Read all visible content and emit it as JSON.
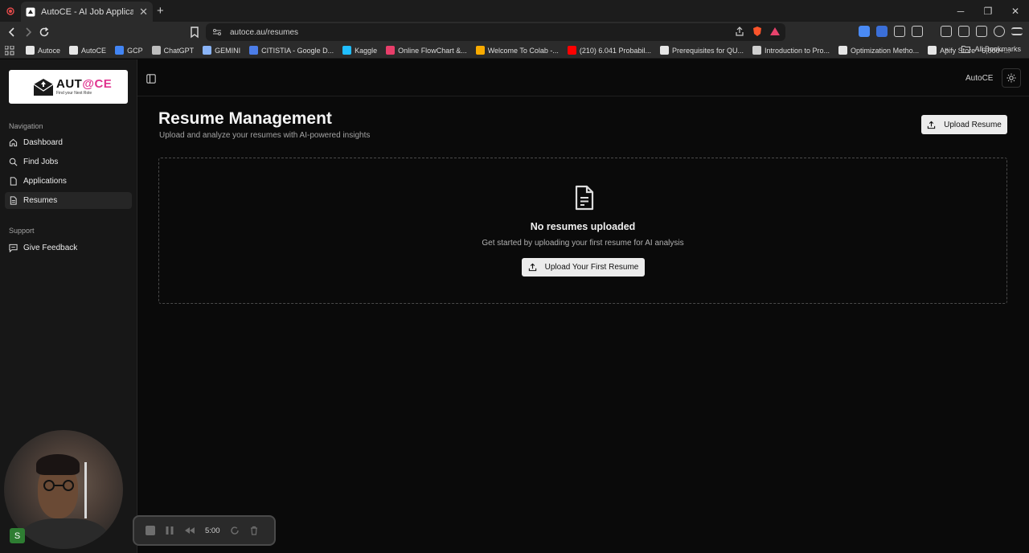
{
  "browser": {
    "tab_title": "AutoCE - AI Job Application Assi",
    "url": "autoce.au/resumes",
    "bookmarks": [
      {
        "label": "Autoce",
        "color": "#e6e6e6"
      },
      {
        "label": "AutoCE",
        "color": "#e6e6e6"
      },
      {
        "label": "GCP",
        "color": "#4285f4"
      },
      {
        "label": "ChatGPT",
        "color": "#bdbdbd"
      },
      {
        "label": "GEMINI",
        "color": "#8ab4f8"
      },
      {
        "label": "CITISTIA - Google D...",
        "color": "#4c7de8"
      },
      {
        "label": "Kaggle",
        "color": "#20beff"
      },
      {
        "label": "Online FlowChart &...",
        "color": "#e83e6a"
      },
      {
        "label": "Welcome To Colab -...",
        "color": "#f9ab00"
      },
      {
        "label": "(210) 6.041 Probabil...",
        "color": "#ff0000"
      },
      {
        "label": "Prerequisites for QU...",
        "color": "#e6e6e6"
      },
      {
        "label": "Introduction to Pro...",
        "color": "#cfcfcf"
      },
      {
        "label": "Optimization Metho...",
        "color": "#e6e6e6"
      },
      {
        "label": "Apify Store - 6,000+...",
        "color": "#e6e6e6"
      }
    ],
    "all_bookmarks": "All Bookmarks"
  },
  "sidebar": {
    "logo": {
      "main_prefix": "AUT",
      "main_accent": "@CE",
      "tagline": "Find your Next Role"
    },
    "nav_label": "Navigation",
    "nav_items": [
      {
        "label": "Dashboard",
        "icon": "home-icon"
      },
      {
        "label": "Find Jobs",
        "icon": "search-icon"
      },
      {
        "label": "Applications",
        "icon": "file-icon"
      },
      {
        "label": "Resumes",
        "icon": "file-text-icon"
      }
    ],
    "support_label": "Support",
    "support_items": [
      {
        "label": "Give Feedback",
        "icon": "message-icon"
      }
    ]
  },
  "header": {
    "brand": "AutoCE"
  },
  "main": {
    "title": "Resume Management",
    "subtitle": "Upload and analyze your resumes with AI-powered insights",
    "upload_label": "Upload Resume",
    "empty": {
      "title": "No resumes uploaded",
      "subtitle": "Get started by uploading your first resume for AI analysis",
      "button_label": "Upload Your First Resume"
    }
  },
  "user": {
    "avatar_initial": "S"
  },
  "recorder": {
    "time": "5:00"
  },
  "colors": {
    "accent": "#e0338f",
    "button_bg": "#ececec",
    "active_nav": "#262626"
  }
}
